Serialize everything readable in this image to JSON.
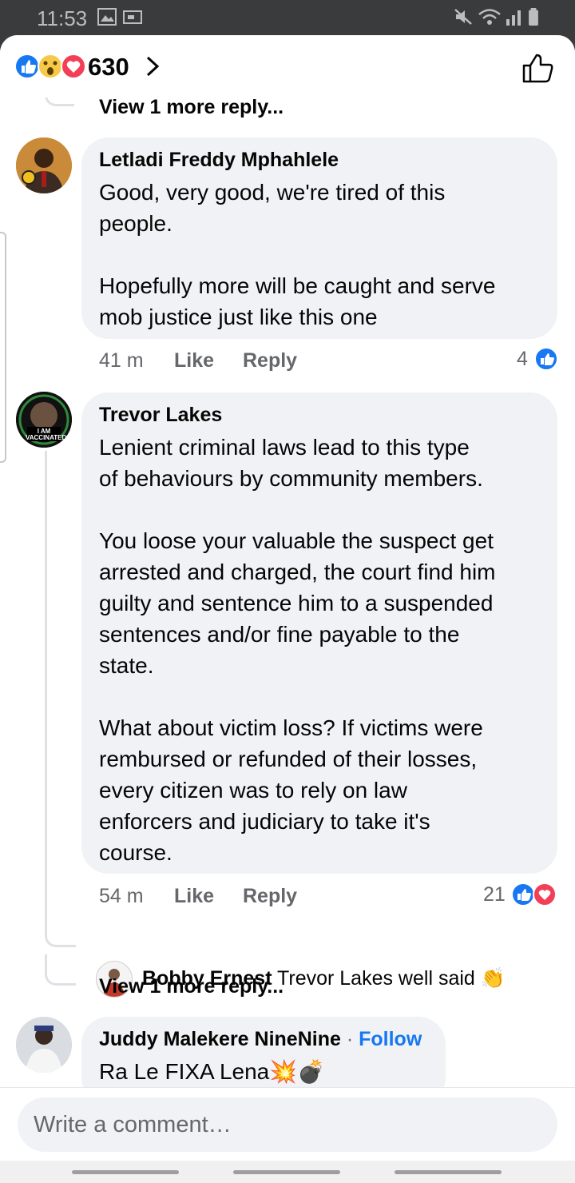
{
  "status_bar": {
    "time": "11:53"
  },
  "header": {
    "reaction_count": "630",
    "reaction_icons": [
      "like-icon",
      "wow-icon",
      "love-icon"
    ]
  },
  "top": {
    "view_more": "View 1 more reply..."
  },
  "comments": [
    {
      "author": "Letladi Freddy Mphahlele",
      "text": "Good, very good, we're tired of this\npeople.\n\nHopefully more will be caught and serve\nmob justice just like this one",
      "time": "41 m",
      "like": "Like",
      "reply": "Reply",
      "reactions": "4"
    },
    {
      "author": "Trevor Lakes",
      "avatar_badge": "I AM VACCINATED",
      "text": "Lenient criminal laws lead to this type\nof behaviours by community members.\n\nYou loose your valuable the suspect get\narrested and charged, the court find him\nguilty and sentence him to a suspended\nsentences and/or fine payable to the\nstate.\n\nWhat about victim loss? If victims were\nrembursed or refunded of their losses,\nevery citizen was to rely on law\nenforcers and judiciary to take it's\ncourse.",
      "time": "54 m",
      "like": "Like",
      "reply": "Reply",
      "reactions": "21",
      "reply_preview": {
        "author": "Bobby Ernest",
        "text": "Trevor Lakes well said 👏"
      },
      "view_more": "View 1 more reply..."
    },
    {
      "author": "Juddy Malekere NineNine",
      "separator": "·",
      "follow": "Follow",
      "text": "Ra Le FIXA Lena💥💣"
    }
  ],
  "composer": {
    "placeholder": "Write a comment…"
  }
}
